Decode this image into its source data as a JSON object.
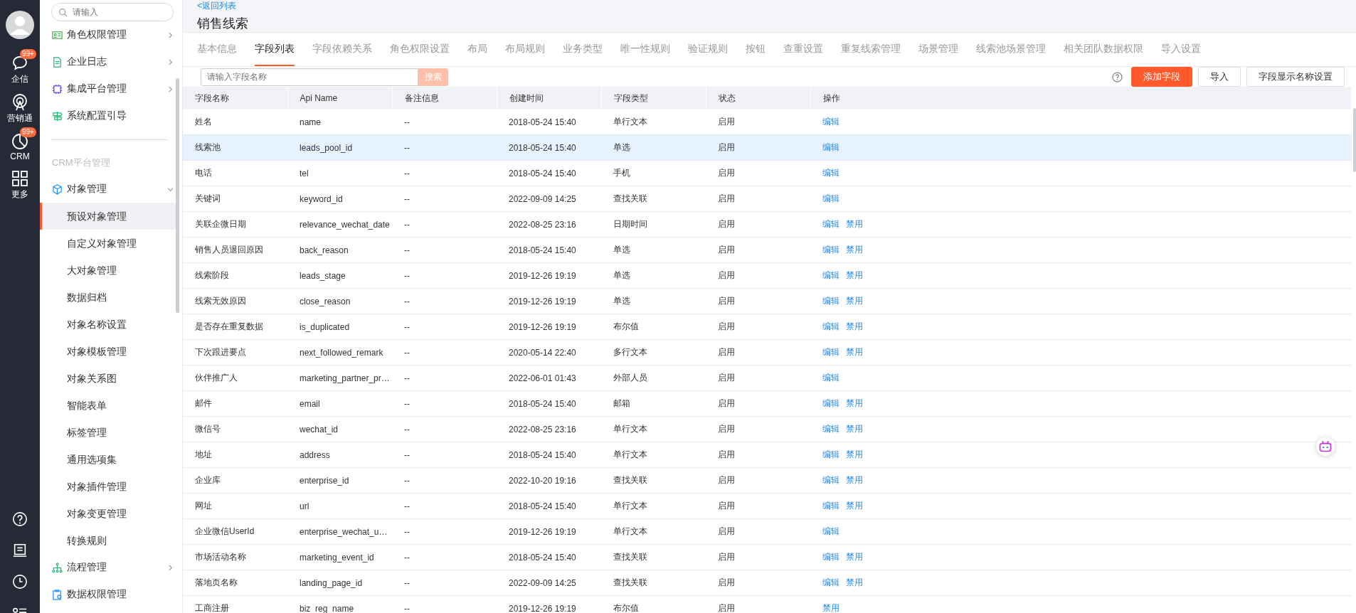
{
  "rail": {
    "items": [
      {
        "kind": "chat",
        "label": "企信",
        "badge": "99+"
      },
      {
        "kind": "signal",
        "label": "营销通"
      },
      {
        "kind": "pie",
        "label": "CRM",
        "badge": "99+"
      },
      {
        "kind": "grid",
        "label": "更多"
      }
    ]
  },
  "nav": {
    "search": {
      "placeholder": "请输入"
    },
    "top_items": [
      {
        "kind": "card",
        "label": "角色权限管理",
        "arrow": true
      },
      {
        "kind": "doc",
        "label": "企业日志",
        "arrow": true
      },
      {
        "kind": "chip",
        "label": "集成平台管理",
        "arrow": true
      },
      {
        "kind": "sign",
        "label": "系统配置引导",
        "arrow": false
      }
    ],
    "section": "CRM平台管理",
    "group": {
      "kind": "cube",
      "label": "对象管理",
      "expanded": true,
      "children": [
        {
          "label": "预设对象管理",
          "selected": true
        },
        {
          "label": "自定义对象管理",
          "selected": false
        },
        {
          "label": "大对象管理",
          "selected": false
        },
        {
          "label": "数据归档",
          "selected": false
        },
        {
          "label": "对象名称设置",
          "selected": false
        },
        {
          "label": "对象模板管理",
          "selected": false
        },
        {
          "label": "对象关系图",
          "selected": false
        },
        {
          "label": "智能表单",
          "selected": false
        },
        {
          "label": "标签管理",
          "selected": false
        },
        {
          "label": "通用选项集",
          "selected": false
        },
        {
          "label": "对象插件管理",
          "selected": false
        },
        {
          "label": "对象变更管理",
          "selected": false
        },
        {
          "label": "转换规则",
          "selected": false
        }
      ]
    },
    "bottom_items": [
      {
        "kind": "tree",
        "label": "流程管理",
        "arrow": true
      },
      {
        "kind": "clip",
        "label": "数据权限管理",
        "arrow": false
      }
    ]
  },
  "header": {
    "back_link": "<返回列表",
    "title": "销售线索"
  },
  "tabs": [
    {
      "label": "基本信息",
      "selected": false
    },
    {
      "label": "字段列表",
      "selected": true
    },
    {
      "label": "字段依赖关系",
      "selected": false
    },
    {
      "label": "角色权限设置",
      "selected": false
    },
    {
      "label": "布局",
      "selected": false
    },
    {
      "label": "布局规则",
      "selected": false
    },
    {
      "label": "业务类型",
      "selected": false
    },
    {
      "label": "唯一性规则",
      "selected": false
    },
    {
      "label": "验证规则",
      "selected": false
    },
    {
      "label": "按钮",
      "selected": false
    },
    {
      "label": "查重设置",
      "selected": false
    },
    {
      "label": "重复线索管理",
      "selected": false
    },
    {
      "label": "场景管理",
      "selected": false
    },
    {
      "label": "线索池场景管理",
      "selected": false
    },
    {
      "label": "相关团队数据权限",
      "selected": false
    },
    {
      "label": "导入设置",
      "selected": false
    }
  ],
  "toolbar": {
    "search": {
      "placeholder": "请输入字段名称",
      "button": "搜索"
    },
    "buttons": [
      {
        "kind": "primary",
        "label": "添加字段"
      },
      {
        "kind": "default",
        "label": "导入"
      },
      {
        "kind": "default",
        "label": "字段显示名称设置"
      }
    ]
  },
  "table": {
    "columns": [
      "字段名称",
      "Api Name",
      "备注信息",
      "创建时间",
      "字段类型",
      "状态",
      "操作"
    ],
    "rows": [
      {
        "selected": false,
        "cells": [
          "姓名",
          "name",
          "--",
          "2018-05-24 15:40",
          "单行文本",
          "启用"
        ],
        "actions": [
          "编辑"
        ]
      },
      {
        "selected": true,
        "cells": [
          "线索池",
          "leads_pool_id",
          "--",
          "2018-05-24 15:40",
          "单选",
          "启用"
        ],
        "actions": [
          "编辑"
        ]
      },
      {
        "selected": false,
        "cells": [
          "电话",
          "tel",
          "--",
          "2018-05-24 15:40",
          "手机",
          "启用"
        ],
        "actions": [
          "编辑"
        ]
      },
      {
        "selected": false,
        "cells": [
          "关键词",
          "keyword_id",
          "--",
          "2022-09-09 14:25",
          "查找关联",
          "启用"
        ],
        "actions": [
          "编辑"
        ]
      },
      {
        "selected": false,
        "cells": [
          "关联企微日期",
          "relevance_wechat_date",
          "--",
          "2022-08-25 23:16",
          "日期时间",
          "启用"
        ],
        "actions": [
          "编辑",
          "禁用"
        ]
      },
      {
        "selected": false,
        "cells": [
          "销售人员退回原因",
          "back_reason",
          "--",
          "2018-05-24 15:40",
          "单选",
          "启用"
        ],
        "actions": [
          "编辑",
          "禁用"
        ]
      },
      {
        "selected": false,
        "cells": [
          "线索阶段",
          "leads_stage",
          "--",
          "2019-12-26 19:19",
          "单选",
          "启用"
        ],
        "actions": [
          "编辑",
          "禁用"
        ]
      },
      {
        "selected": false,
        "cells": [
          "线索无效原因",
          "close_reason",
          "--",
          "2019-12-26 19:19",
          "单选",
          "启用"
        ],
        "actions": [
          "编辑",
          "禁用"
        ]
      },
      {
        "selected": false,
        "cells": [
          "是否存在重复数据",
          "is_duplicated",
          "--",
          "2019-12-26 19:19",
          "布尔值",
          "启用"
        ],
        "actions": [
          "编辑",
          "禁用"
        ]
      },
      {
        "selected": false,
        "cells": [
          "下次跟进要点",
          "next_followed_remark",
          "--",
          "2020-05-14 22:40",
          "多行文本",
          "启用"
        ],
        "actions": [
          "编辑",
          "禁用"
        ]
      },
      {
        "selected": false,
        "cells": [
          "伙伴推广人",
          "marketing_partner_pr…",
          "--",
          "2022-06-01 01:43",
          "外部人员",
          "启用"
        ],
        "actions": [
          "编辑"
        ]
      },
      {
        "selected": false,
        "cells": [
          "邮件",
          "email",
          "--",
          "2018-05-24 15:40",
          "邮箱",
          "启用"
        ],
        "actions": [
          "编辑",
          "禁用"
        ]
      },
      {
        "selected": false,
        "cells": [
          "微信号",
          "wechat_id",
          "--",
          "2022-08-25 23:16",
          "单行文本",
          "启用"
        ],
        "actions": [
          "编辑",
          "禁用"
        ]
      },
      {
        "selected": false,
        "cells": [
          "地址",
          "address",
          "--",
          "2018-05-24 15:40",
          "单行文本",
          "启用"
        ],
        "actions": [
          "编辑",
          "禁用"
        ]
      },
      {
        "selected": false,
        "cells": [
          "企业库",
          "enterprise_id",
          "--",
          "2022-10-20 19:16",
          "查找关联",
          "启用"
        ],
        "actions": [
          "编辑",
          "禁用"
        ]
      },
      {
        "selected": false,
        "cells": [
          "网址",
          "url",
          "--",
          "2018-05-24 15:40",
          "单行文本",
          "启用"
        ],
        "actions": [
          "编辑",
          "禁用"
        ]
      },
      {
        "selected": false,
        "cells": [
          "企业微信UserId",
          "enterprise_wechat_u…",
          "--",
          "2019-12-26 19:19",
          "单行文本",
          "启用"
        ],
        "actions": [
          "编辑"
        ]
      },
      {
        "selected": false,
        "cells": [
          "市场活动名称",
          "marketing_event_id",
          "--",
          "2018-05-24 15:40",
          "查找关联",
          "启用"
        ],
        "actions": [
          "编辑",
          "禁用"
        ]
      },
      {
        "selected": false,
        "cells": [
          "落地页名称",
          "landing_page_id",
          "--",
          "2022-09-09 14:25",
          "查找关联",
          "启用"
        ],
        "actions": [
          "编辑",
          "禁用"
        ]
      },
      {
        "selected": false,
        "cells": [
          "工商注册",
          "biz_reg_name",
          "--",
          "2019-12-26 19:19",
          "布尔值",
          "启用"
        ],
        "actions": [
          "禁用"
        ]
      }
    ]
  }
}
